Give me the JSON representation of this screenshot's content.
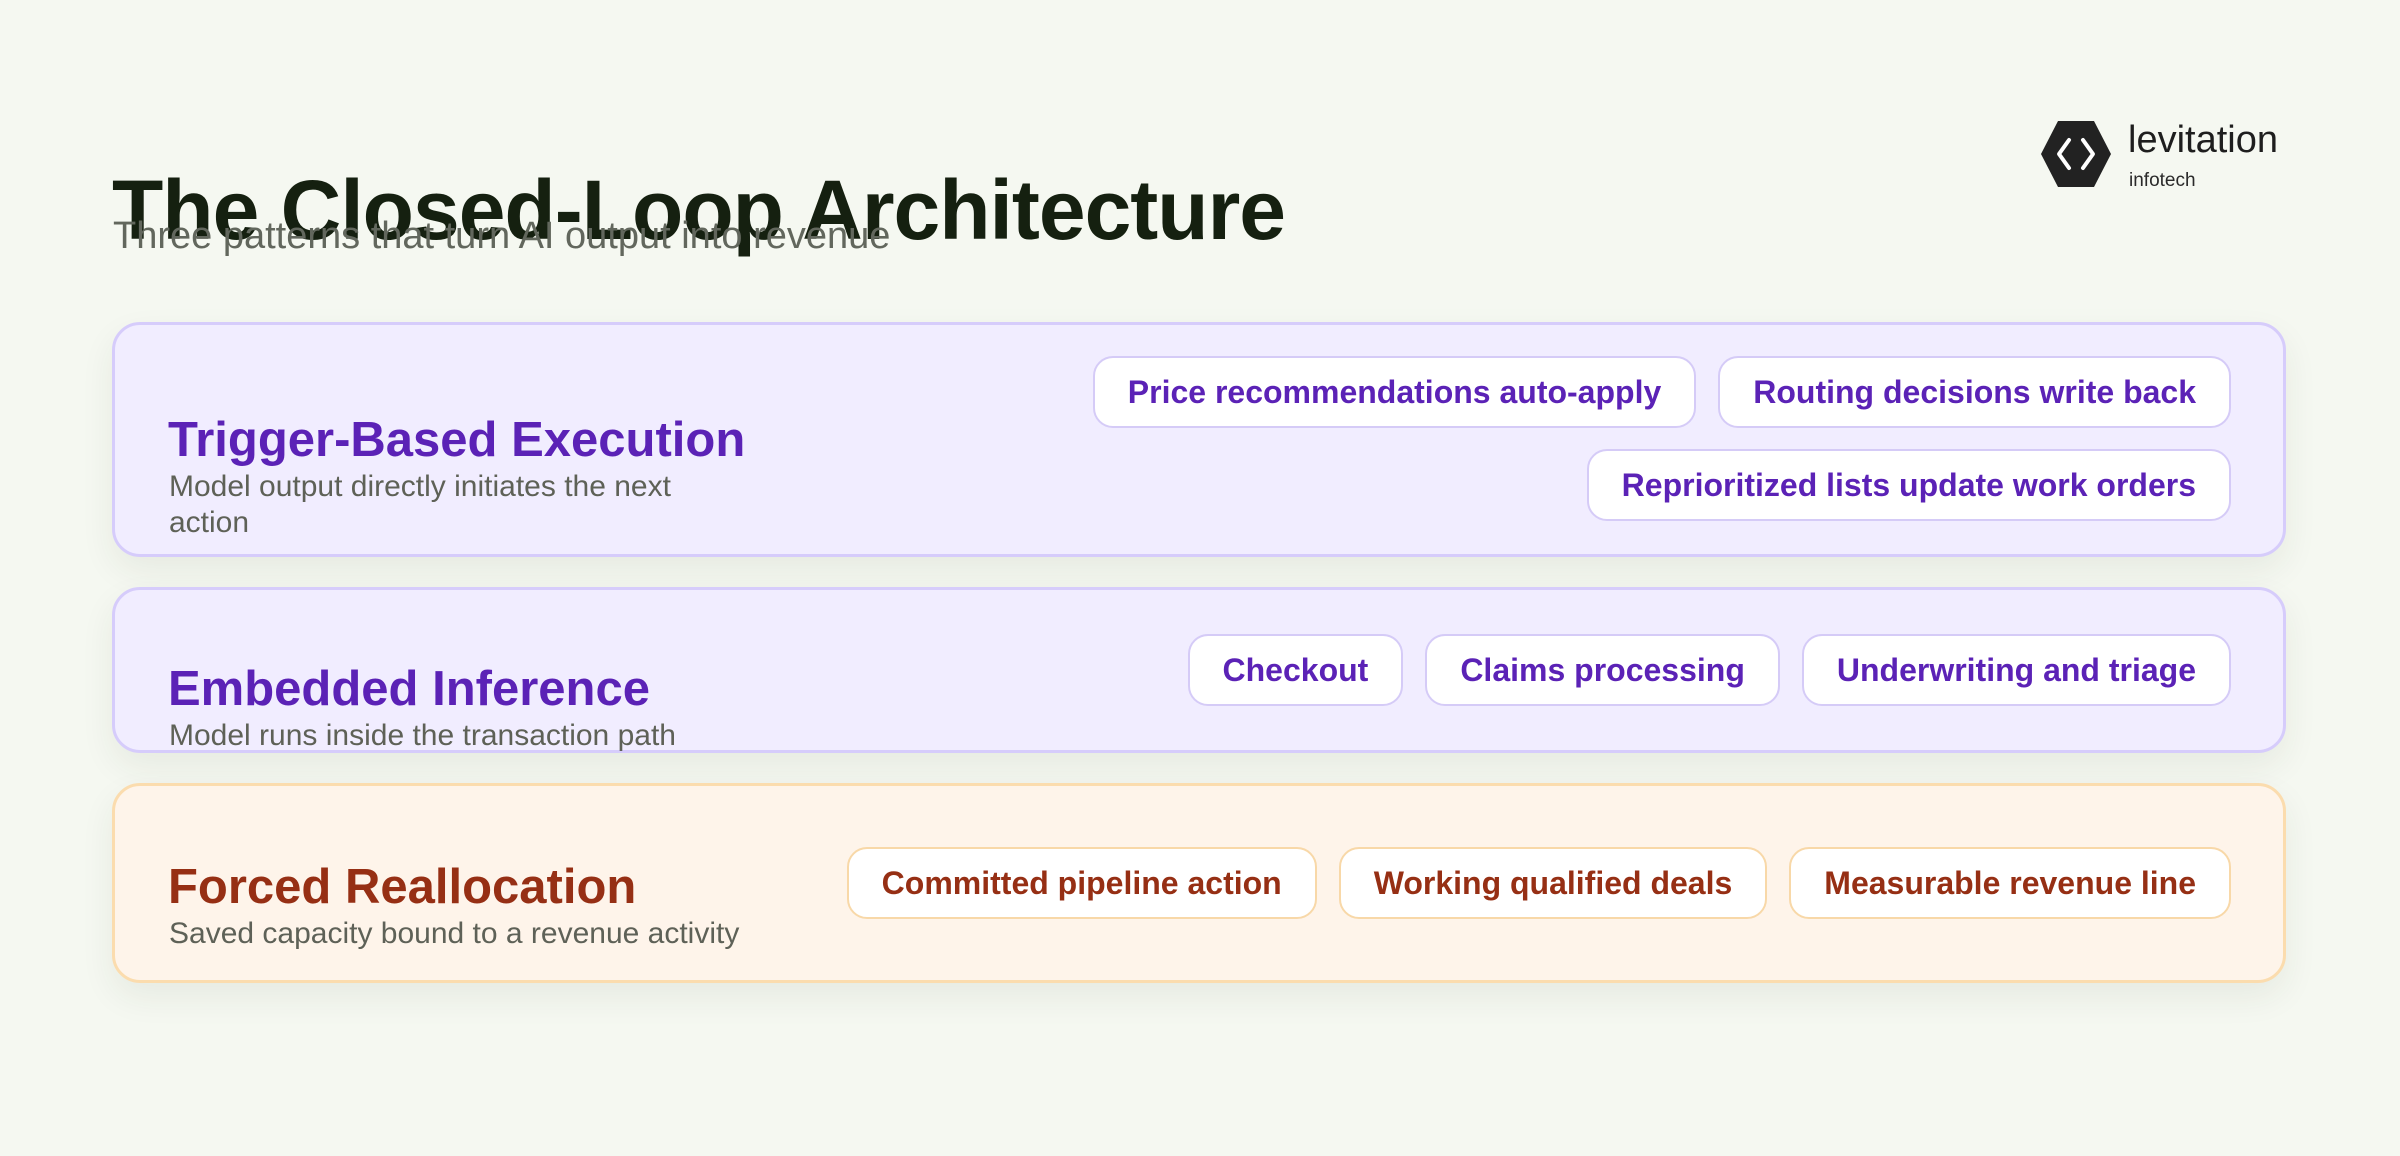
{
  "header": {
    "title": "The Closed-Loop Architecture",
    "subtitle": "Three patterns that turn AI output into revenue"
  },
  "logo": {
    "name": "levitation",
    "tagline": "infotech",
    "icon": "hexagon-code-brackets-icon"
  },
  "colors": {
    "background": "#f5f8f1",
    "title": "#152010",
    "purple_accent": "#5b22b6",
    "purple_panel": "#f1edff",
    "orange_accent": "#962f14",
    "orange_panel": "#fef4ea"
  },
  "patterns": [
    {
      "title": "Trigger-Based Execution",
      "description": "Model output directly initiates the next action",
      "tags": [
        "Price recommendations auto-apply",
        "Routing decisions write back",
        "Reprioritized lists update work orders"
      ]
    },
    {
      "title": "Embedded Inference",
      "description": "Model runs inside the transaction path",
      "tags": [
        "Checkout",
        "Claims processing",
        "Underwriting and triage"
      ]
    },
    {
      "title": "Forced Reallocation",
      "description": "Saved capacity bound to a revenue activity",
      "tags": [
        "Committed pipeline action",
        "Working qualified deals",
        "Measurable revenue line"
      ]
    }
  ]
}
